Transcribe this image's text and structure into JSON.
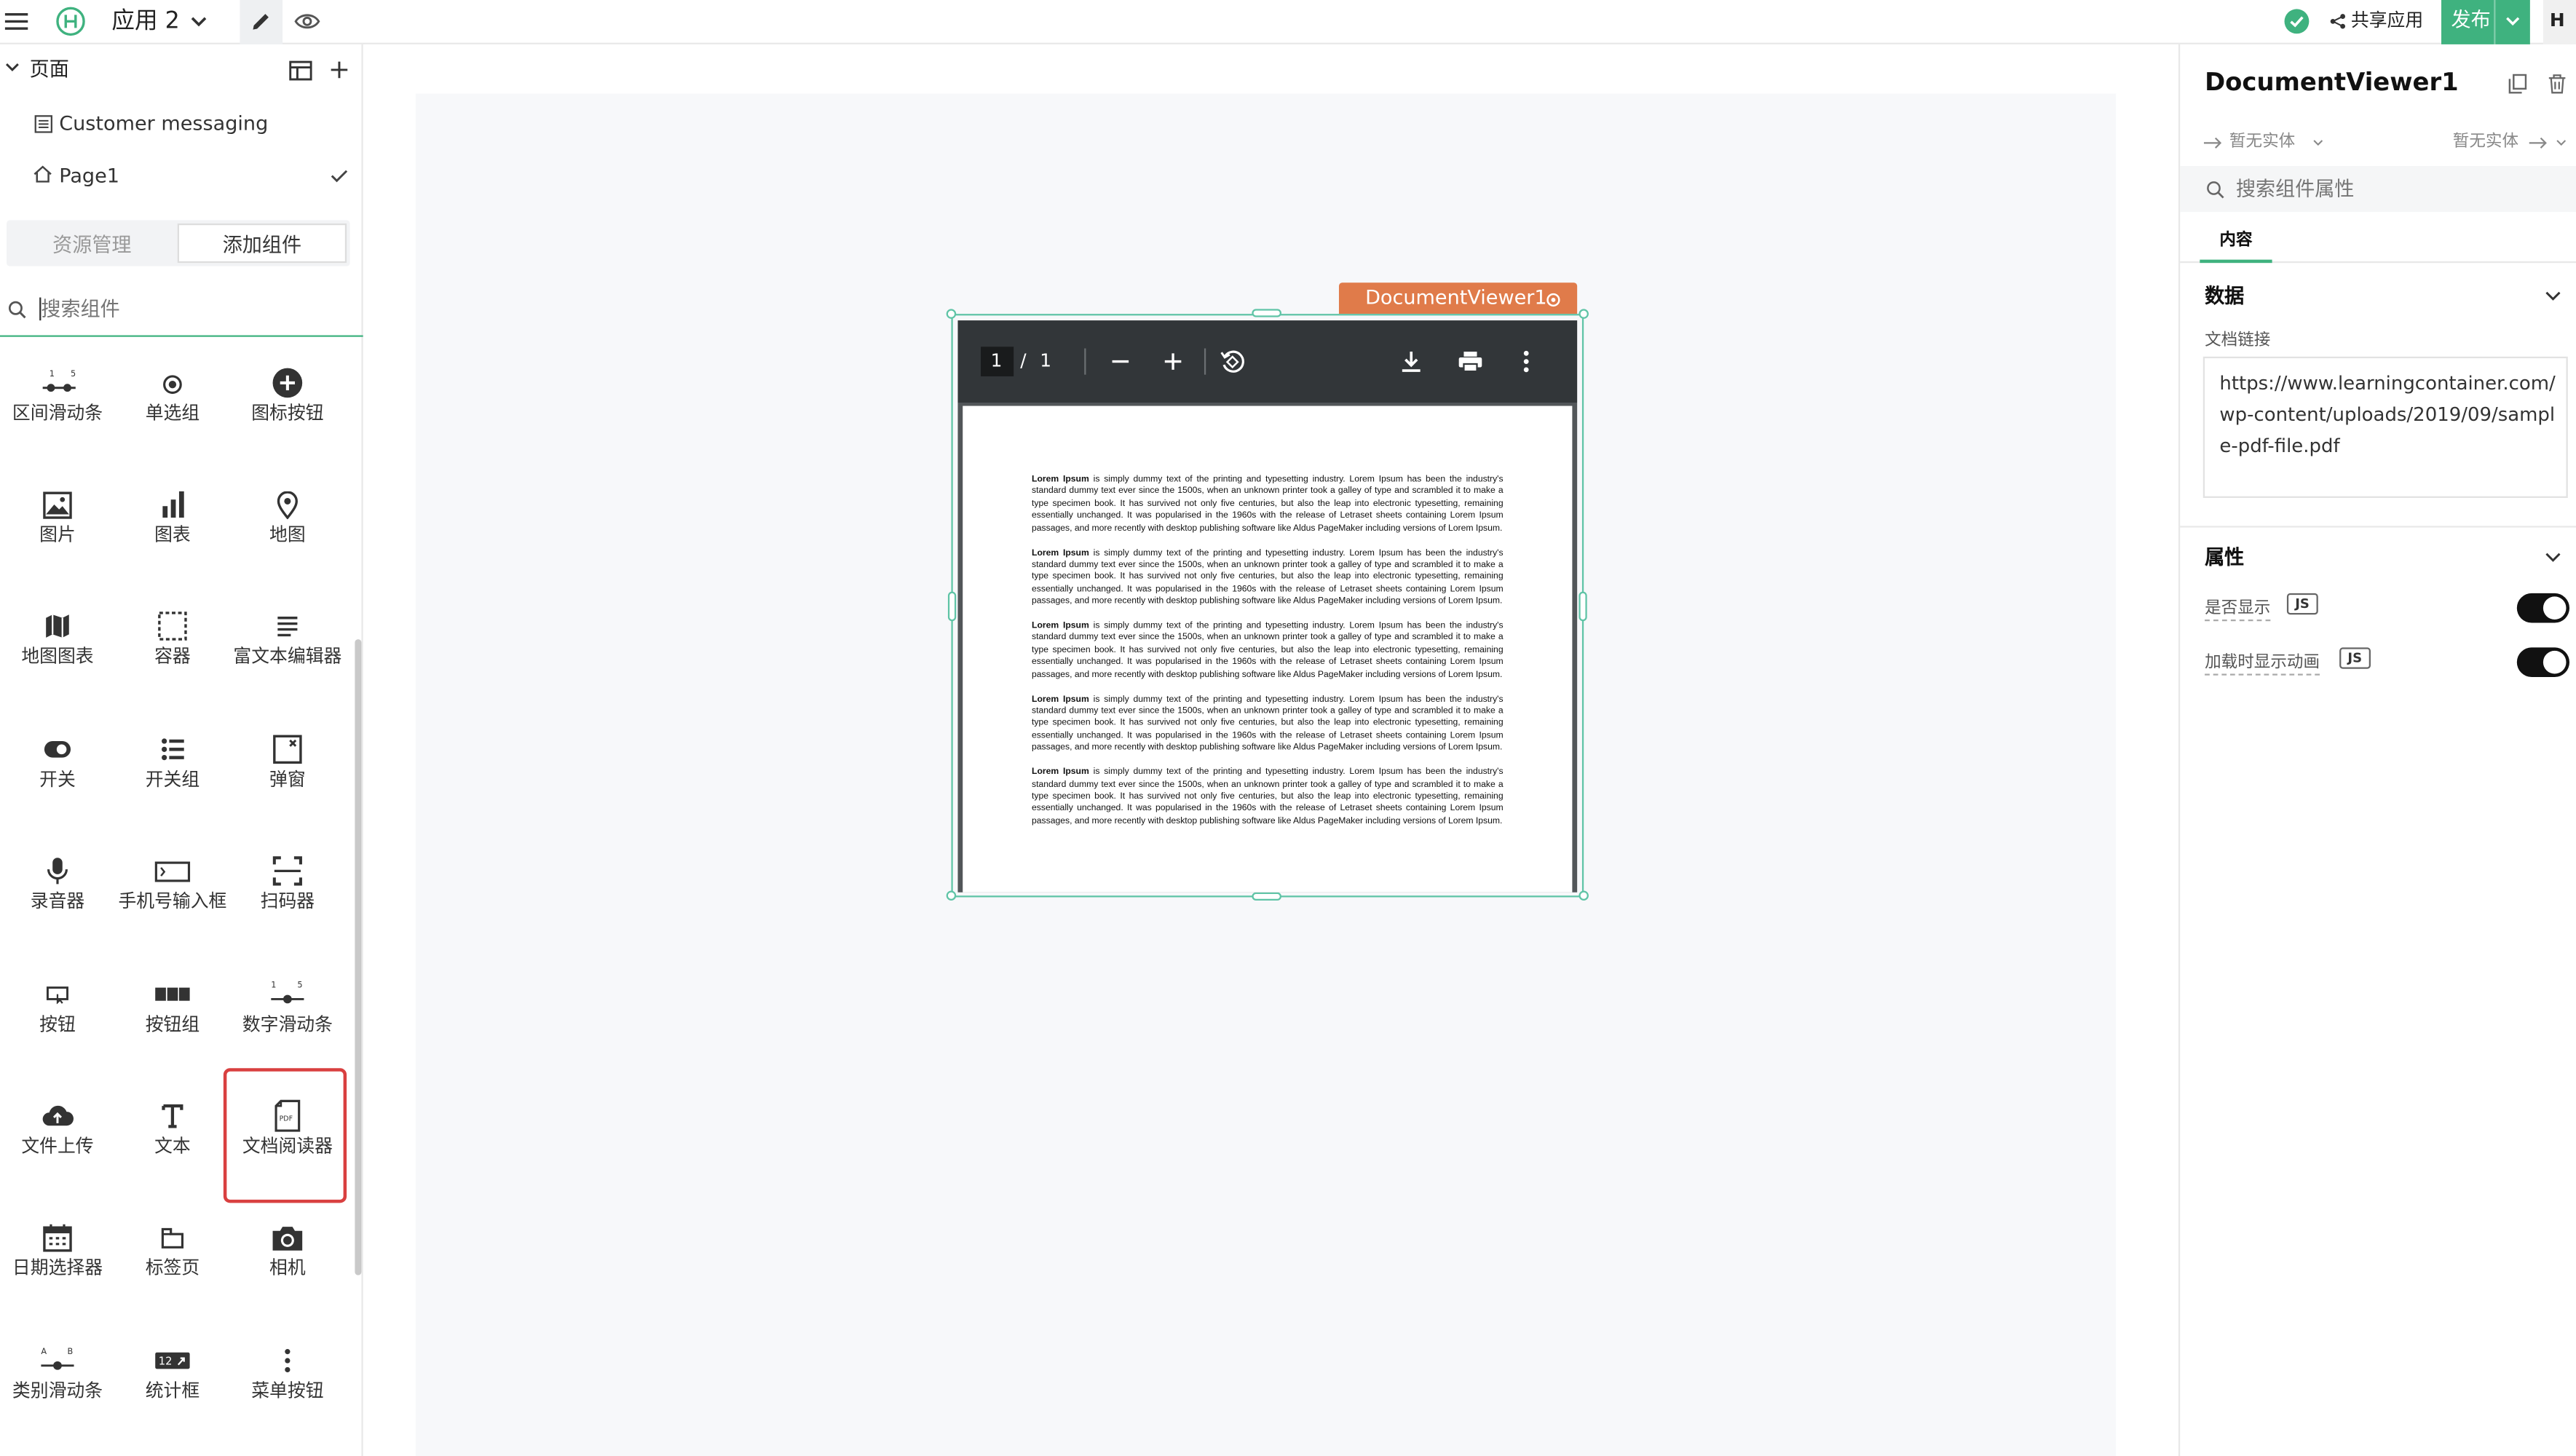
{
  "topbar": {
    "app_name": "应用 2",
    "share_label": "共享应用",
    "publish_label": "发布",
    "avatar_initial": "H"
  },
  "left": {
    "pages_title": "页面",
    "pages": [
      {
        "label": "Customer messaging"
      },
      {
        "label": "Page1"
      }
    ],
    "tabs": {
      "resources": "资源管理",
      "add_component": "添加组件"
    },
    "search_placeholder": "搜索组件",
    "components": [
      {
        "label": "区间滑动条",
        "icon": "range-slider-icon"
      },
      {
        "label": "单选组",
        "icon": "radio-icon"
      },
      {
        "label": "图标按钮",
        "icon": "plus-circle-icon"
      },
      {
        "label": "图片",
        "icon": "image-icon"
      },
      {
        "label": "图表",
        "icon": "bar-chart-icon"
      },
      {
        "label": "地图",
        "icon": "map-pin-icon"
      },
      {
        "label": "地图图表",
        "icon": "map-icon"
      },
      {
        "label": "容器",
        "icon": "container-icon"
      },
      {
        "label": "富文本编辑器",
        "icon": "rich-text-icon"
      },
      {
        "label": "开关",
        "icon": "toggle-icon"
      },
      {
        "label": "开关组",
        "icon": "switch-group-icon"
      },
      {
        "label": "弹窗",
        "icon": "modal-icon"
      },
      {
        "label": "录音器",
        "icon": "microphone-icon"
      },
      {
        "label": "手机号输入框",
        "icon": "phone-input-icon"
      },
      {
        "label": "扫码器",
        "icon": "scanner-icon"
      },
      {
        "label": "按钮",
        "icon": "button-icon"
      },
      {
        "label": "按钮组",
        "icon": "button-group-icon"
      },
      {
        "label": "数字滑动条",
        "icon": "number-slider-icon"
      },
      {
        "label": "文件上传",
        "icon": "upload-cloud-icon"
      },
      {
        "label": "文本",
        "icon": "text-icon"
      },
      {
        "label": "文档阅读器",
        "icon": "pdf-icon"
      },
      {
        "label": "日期选择器",
        "icon": "calendar-icon"
      },
      {
        "label": "标签页",
        "icon": "tabs-icon"
      },
      {
        "label": "相机",
        "icon": "camera-icon"
      },
      {
        "label": "类别滑动条",
        "icon": "category-slider-icon"
      },
      {
        "label": "统计框",
        "icon": "stat-box-icon"
      },
      {
        "label": "菜单按钮",
        "icon": "menu-dots-icon"
      }
    ],
    "range_slider_marks": [
      "1",
      "5"
    ],
    "number_slider_marks": [
      "1",
      "5"
    ],
    "category_slider_marks": [
      "A",
      "B"
    ],
    "stat_box_text": "12"
  },
  "canvas": {
    "component_tag": "DocumentViewer1",
    "viewer": {
      "page_current": "1",
      "page_sep": "/",
      "page_total": "1",
      "paragraph_lead": "Lorem Ipsum",
      "paragraph_body": " is simply dummy text of the printing and typesetting industry. Lorem Ipsum has been the industry's standard dummy text ever since the 1500s, when an unknown printer took a galley of type and scrambled it to make a type specimen book. It has survived not only five centuries, but also the leap into electronic typesetting, remaining essentially unchanged. It was popularised in the 1960s with the release of Letraset sheets containing Lorem Ipsum passages, and more recently with desktop publishing software like Aldus PageMaker including versions of Lorem Ipsum."
    }
  },
  "right": {
    "title": "DocumentViewer1",
    "entity_left": "暂无实体",
    "entity_right": "暂无实体",
    "search_placeholder": "搜索组件属性",
    "tab_content": "内容",
    "section_data": "数据",
    "field_doc_link_label": "文档链接",
    "field_doc_link_value": "https://www.learningcontainer.com/wp-content/uploads/2019/09/sample-pdf-file.pdf",
    "section_props": "属性",
    "prop_visible": "是否显示",
    "prop_animate": "加载时显示动画",
    "js_label": "JS",
    "toggle_visible_on": true,
    "toggle_animate_on": true
  },
  "colors": {
    "accent_green": "#3fb27f",
    "tag_orange": "#e07b4a",
    "highlight_red": "#d94040",
    "selection_teal": "#5fc4a6",
    "viewer_toolbar": "#323639"
  }
}
